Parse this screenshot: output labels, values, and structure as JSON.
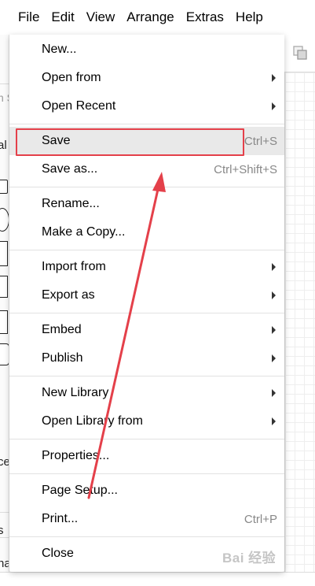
{
  "menubar": {
    "items": [
      "File",
      "Edit",
      "View",
      "Arrange",
      "Extras",
      "Help"
    ]
  },
  "background": {
    "fragments": [
      "n S",
      "al",
      "ce",
      "s",
      "ha"
    ]
  },
  "file_menu": {
    "items": [
      {
        "label": "New...",
        "shortcut": "",
        "submenu": false
      },
      {
        "label": "Open from",
        "shortcut": "",
        "submenu": true
      },
      {
        "label": "Open Recent",
        "shortcut": "",
        "submenu": true
      },
      {
        "label": "Save",
        "shortcut": "Ctrl+S",
        "submenu": false
      },
      {
        "label": "Save as...",
        "shortcut": "Ctrl+Shift+S",
        "submenu": false
      },
      {
        "label": "Rename...",
        "shortcut": "",
        "submenu": false
      },
      {
        "label": "Make a Copy...",
        "shortcut": "",
        "submenu": false
      },
      {
        "label": "Import from",
        "shortcut": "",
        "submenu": true
      },
      {
        "label": "Export as",
        "shortcut": "",
        "submenu": true
      },
      {
        "label": "Embed",
        "shortcut": "",
        "submenu": true
      },
      {
        "label": "Publish",
        "shortcut": "",
        "submenu": true
      },
      {
        "label": "New Library",
        "shortcut": "",
        "submenu": true
      },
      {
        "label": "Open Library from",
        "shortcut": "",
        "submenu": true
      },
      {
        "label": "Properties...",
        "shortcut": "",
        "submenu": false
      },
      {
        "label": "Page Setup...",
        "shortcut": "",
        "submenu": false
      },
      {
        "label": "Print...",
        "shortcut": "Ctrl+P",
        "submenu": false
      },
      {
        "label": "Close",
        "shortcut": "",
        "submenu": false
      }
    ],
    "hovered_item": "Save"
  },
  "annotation": {
    "color": "#e4404a",
    "target": "Save"
  },
  "watermark": {
    "text": "Bai 经验"
  }
}
